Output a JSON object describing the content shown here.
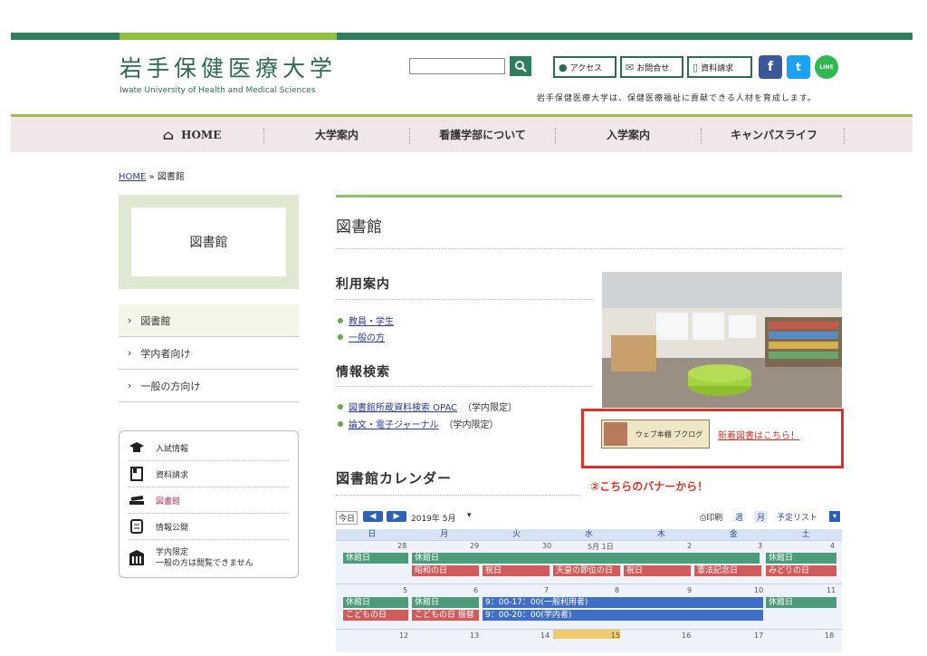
{
  "header": {
    "title_jp": "岩手保健医療大学",
    "title_en": "Iwate University of Health and Medical Sciences",
    "buttons": [
      "アクセス",
      "お問合せ",
      "資料請求"
    ],
    "sns": {
      "facebook": "f",
      "twitter": "t",
      "line": "LINE"
    },
    "tagline": "岩手保健医療大学は、保健医療福祉に貢献できる人材を育成します。",
    "colors": {
      "brand": "#2f7f5c",
      "accent": "#8fbf3f"
    }
  },
  "nav": [
    "HOME",
    "大学案内",
    "看護学部について",
    "入学案内",
    "キャンパスライフ"
  ],
  "breadcrumb": {
    "home": "HOME",
    "sep": "»",
    "current": "図書館"
  },
  "sidebar": {
    "box_title": "図書館",
    "menu": [
      "図書館",
      "学内者向け",
      "一般の方向け"
    ],
    "links": [
      "入試情報",
      "資料請求",
      "図書館",
      "情報公開"
    ],
    "restricted": {
      "title": "学内限定",
      "note": "一般の方は閲覧できません"
    }
  },
  "main": {
    "title": "図書館",
    "usage_heading": "利用案内",
    "usage_links": [
      "教員・学生",
      "一般の方"
    ],
    "search_heading": "情報検索",
    "search_links": [
      {
        "link": "図書館所蔵資料検索 OPAC",
        "note": "（学内限定）"
      },
      {
        "link": "論文・電子ジャーナル",
        "note": "（学内限定）"
      }
    ],
    "banner_text": "ウェブ本棚 ブクログ",
    "new_books": "新着図書はこちら！",
    "annotation": "②こちらのバナーから！",
    "calendar_heading": "図書館カレンダー"
  },
  "calendar": {
    "today": "今日",
    "month": "2019年 5月",
    "print": "印刷",
    "views": [
      "週",
      "月",
      "予定リスト"
    ],
    "weekdays": [
      "日",
      "月",
      "火",
      "水",
      "木",
      "金",
      "土"
    ],
    "week1_dates": [
      "28",
      "29",
      "30",
      "5月 1日",
      "2",
      "3",
      "4"
    ],
    "week2_dates": [
      "5",
      "6",
      "7",
      "8",
      "9",
      "10",
      "11"
    ],
    "week3_dates": [
      "12",
      "13",
      "14",
      "15",
      "16",
      "17",
      "18"
    ],
    "events": {
      "closed": "休館日",
      "showa": "昭和の日",
      "holiday": "祝日",
      "enthronement": "天皇の即位の日",
      "constitution": "憲法記念日",
      "greenery": "みどりの日",
      "children": "こどもの日",
      "children_sub": "こどもの日 振替",
      "hours_public": "9：00-17：00(一般利用者)",
      "hours_internal": "9：00-20：00(学内者)"
    }
  }
}
